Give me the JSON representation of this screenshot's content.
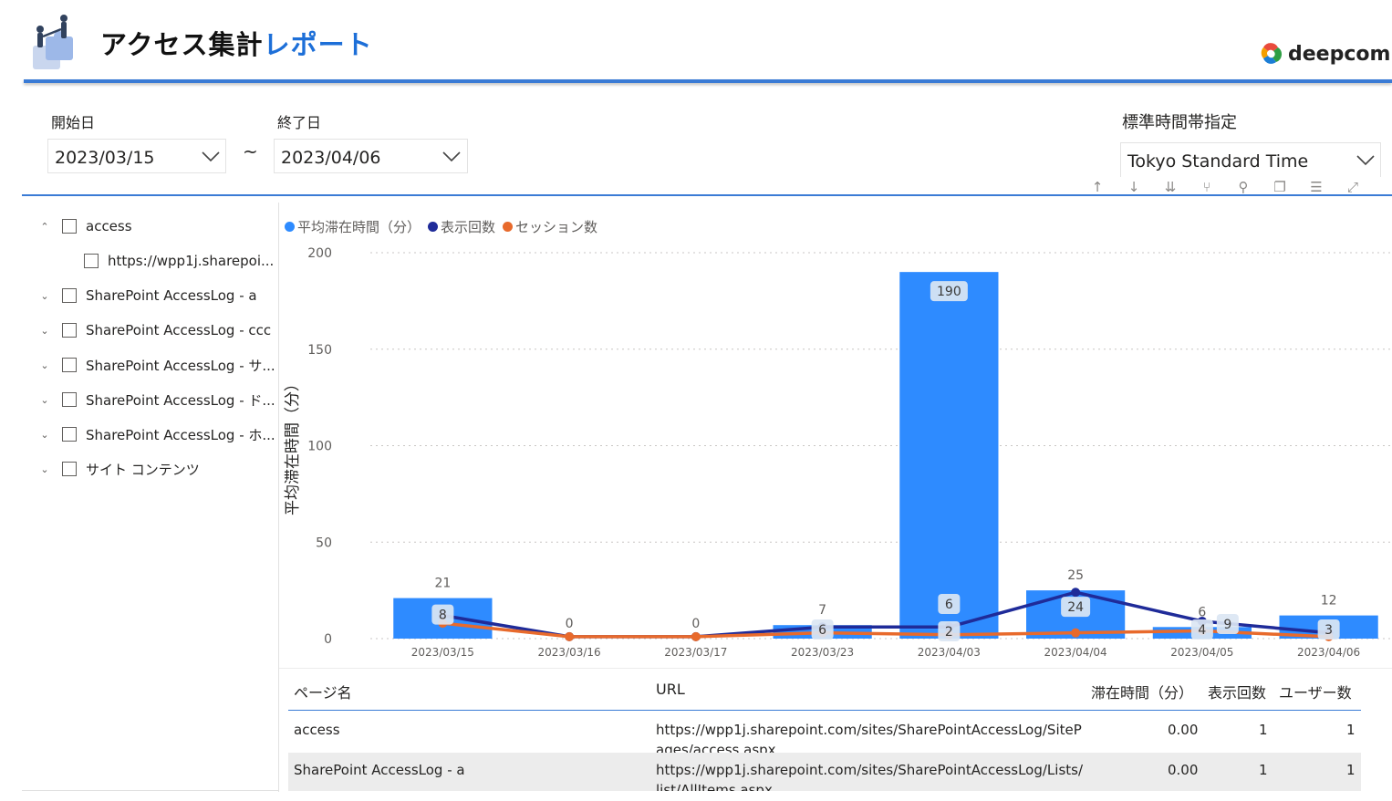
{
  "header": {
    "title_part1": "アクセス集計",
    "title_part2": "レポート",
    "brand": "deepcom"
  },
  "filters": {
    "start_label": "開始日",
    "start_value": "2023/03/15",
    "separator": "~",
    "end_label": "終了日",
    "end_value": "2023/04/06",
    "tz_label": "標準時間帯指定",
    "tz_value": "Tokyo Standard Time"
  },
  "tree": {
    "items": [
      {
        "label": "access",
        "expanded": true
      },
      {
        "label": "https://wpp1j.sharepoi...",
        "child": true
      },
      {
        "label": "SharePoint AccessLog - a"
      },
      {
        "label": "SharePoint AccessLog - ccc"
      },
      {
        "label": "SharePoint AccessLog - サ..."
      },
      {
        "label": "SharePoint AccessLog - ド..."
      },
      {
        "label": "SharePoint AccessLog - ホ..."
      },
      {
        "label": "サイト コンテンツ"
      }
    ]
  },
  "visual_icons": [
    "arrow-up-icon",
    "arrow-down-icon",
    "double-arrow-down-icon",
    "expand-hierarchy-icon",
    "pin-icon",
    "copy-icon",
    "filter-icon",
    "focus-mode-icon"
  ],
  "chart_data": {
    "type": "bar",
    "categories": [
      "2023/03/15",
      "2023/03/16",
      "2023/03/17",
      "2023/03/23",
      "2023/04/03",
      "2023/04/04",
      "2023/04/05",
      "2023/04/06"
    ],
    "ylabel": "平均滞在時間（分）",
    "ylim": [
      0,
      200
    ],
    "yticks": [
      0,
      50,
      100,
      150,
      200
    ],
    "grid": true,
    "legend_position": "top-left",
    "series": [
      {
        "name": "平均滞在時間（分）",
        "kind": "bar",
        "color": "#2e8bff",
        "values": [
          21,
          0,
          0,
          7,
          190,
          25,
          6,
          12
        ]
      },
      {
        "name": "表示回数",
        "kind": "line",
        "color": "#1f2b99",
        "values": [
          12,
          1,
          1,
          6,
          6,
          24,
          9,
          3
        ]
      },
      {
        "name": "セッション数",
        "kind": "line",
        "color": "#e86a2c",
        "values": [
          8,
          1,
          1,
          3,
          2,
          3,
          4,
          1
        ]
      }
    ],
    "bar_top_labels": [
      "21",
      "0",
      "0",
      "7",
      "",
      "25",
      "6",
      "12"
    ],
    "bar_inner_labels": [
      "8",
      "",
      "",
      "6",
      "190",
      "24",
      "4",
      "3"
    ],
    "bar_mid_labels": [
      "",
      "",
      "",
      "",
      "6",
      "",
      "9",
      ""
    ],
    "bar_low_labels": [
      "",
      "",
      "",
      "",
      "2",
      "",
      "",
      ""
    ]
  },
  "table": {
    "headers": [
      "ページ名",
      "URL",
      "滞在時間（分）",
      "表示回数",
      "ユーザー数"
    ],
    "rows": [
      {
        "page": "access",
        "url": "https://wpp1j.sharepoint.com/sites/SharePointAccessLog/SitePages/access.aspx",
        "time": "0.00",
        "views": "1",
        "users": "1"
      },
      {
        "page": "SharePoint AccessLog - a",
        "url": "https://wpp1j.sharepoint.com/sites/SharePointAccessLog/Lists/list/AllItems.aspx",
        "time": "0.00",
        "views": "1",
        "users": "1"
      }
    ]
  }
}
